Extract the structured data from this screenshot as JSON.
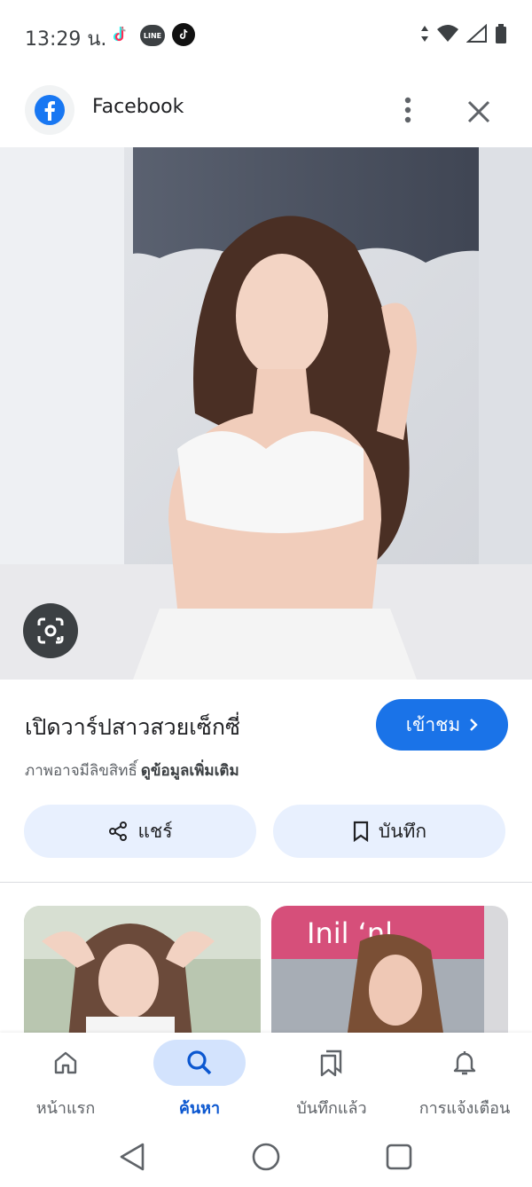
{
  "status_bar": {
    "time": "13:29 น.",
    "apps": [
      "tiktok-icon",
      "line-icon",
      "tiktok-icon"
    ],
    "line_label": "LINE"
  },
  "header": {
    "site_name": "Facebook"
  },
  "result": {
    "title": "เปิดวาร์ปสาวสวยเซ็กซี่",
    "visit_label": "เข้าชม",
    "copyright_text": "ภาพอาจมีลิขสิทธิ์",
    "more_info_label": "ดูข้อมูลเพิ่มเติม",
    "share_label": "แชร์",
    "save_label": "บันทึก"
  },
  "related_images": [
    {
      "name": "related-image-1"
    },
    {
      "name": "related-image-2",
      "sign_text": "Inil ʻnl"
    }
  ],
  "bottom_nav": {
    "items": [
      {
        "label": "หน้าแรก",
        "icon": "home-icon",
        "active": false
      },
      {
        "label": "ค้นหา",
        "icon": "search-icon",
        "active": true
      },
      {
        "label": "บันทึกแล้ว",
        "icon": "collections-icon",
        "active": false
      },
      {
        "label": "การแจ้งเตือน",
        "icon": "bell-icon",
        "active": false
      }
    ]
  },
  "colors": {
    "accent": "#1a73e8",
    "active_nav_bg": "#d3e3fd",
    "action_bg": "#e8f0fe"
  }
}
